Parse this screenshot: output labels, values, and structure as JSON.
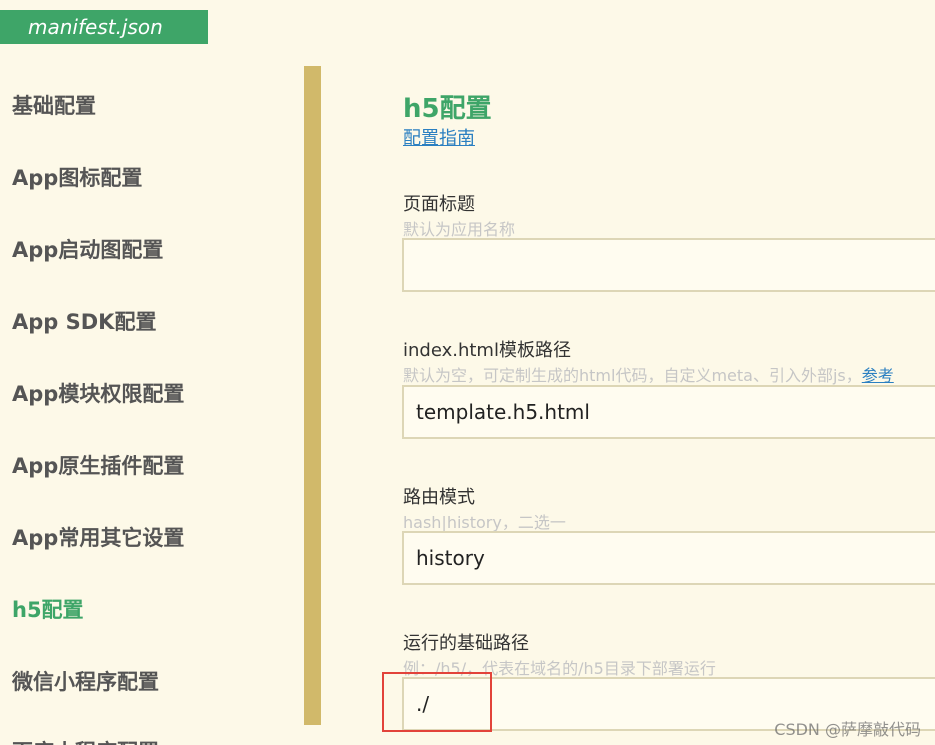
{
  "file_tab": {
    "title": "manifest.json"
  },
  "sidebar": {
    "items": [
      {
        "label": "基础配置"
      },
      {
        "label": "App图标配置"
      },
      {
        "label": "App启动图配置"
      },
      {
        "label": "App SDK配置"
      },
      {
        "label": "App模块权限配置"
      },
      {
        "label": "App原生插件配置"
      },
      {
        "label": "App常用其它设置"
      },
      {
        "label": "h5配置",
        "active": true
      },
      {
        "label": "微信小程序配置"
      },
      {
        "label": "百度小程序配置"
      }
    ]
  },
  "main": {
    "title": "h5配置",
    "guide_link": "配置指南",
    "fields": [
      {
        "label": "页面标题",
        "hint": "默认为应用名称",
        "value": ""
      },
      {
        "label": "index.html模板路径",
        "hint": "默认为空，可定制生成的html代码，自定义meta、引入外部js，",
        "hint_link": "参考",
        "value": "template.h5.html"
      },
      {
        "label": "路由模式",
        "hint": "hash|history，二选一",
        "value": "history"
      },
      {
        "label": "运行的基础路径",
        "hint": "例：/h5/，代表在域名的/h5目录下部署运行",
        "value": "./"
      }
    ]
  },
  "watermark": "CSDN @萨摩敲代码",
  "colors": {
    "accent_green": "#3ea568",
    "divider": "#d1b96a",
    "background": "#fdf9e8",
    "link": "#2a7fc1",
    "highlight": "#e2433a"
  }
}
